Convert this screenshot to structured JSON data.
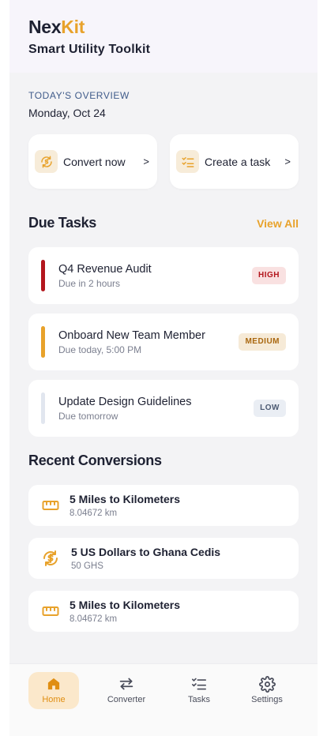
{
  "app": {
    "logo_part1": "Nex",
    "logo_part2": "Kit",
    "subtitle": "Smart Utility Toolkit",
    "accent_color": "#e8a22b"
  },
  "overview": {
    "label": "TODAY'S OVERVIEW",
    "date": "Monday, Oct 24"
  },
  "quick_actions": [
    {
      "label": "Convert now",
      "chevron": ">",
      "icon": "convert-icon"
    },
    {
      "label": "Create a task",
      "chevron": ">",
      "icon": "checklist-icon"
    }
  ],
  "due_tasks": {
    "title": "Due Tasks",
    "view_all": "View All",
    "items": [
      {
        "title": "Q4 Revenue Audit",
        "due": "Due in 2 hours",
        "priority": "HIGH",
        "bar_color": "#b3161d",
        "badge_bg": "#f9e1e1",
        "badge_color": "#b3161d"
      },
      {
        "title": "Onboard New Team Member",
        "due": "Due today, 5:00 PM",
        "priority": "MEDIUM",
        "bar_color": "#e8a22b",
        "badge_bg": "#f6ead7",
        "badge_color": "#a9670f"
      },
      {
        "title": "Update Design Guidelines",
        "due": "Due tomorrow",
        "priority": "LOW",
        "bar_color": "#e1e6ef",
        "badge_bg": "#eaeef4",
        "badge_color": "#4b5a72"
      }
    ]
  },
  "recent_conversions": {
    "title": "Recent Conversions",
    "items": [
      {
        "title": "5 Miles to Kilometers",
        "result": "8.04672 km",
        "icon": "ruler-icon"
      },
      {
        "title": "5 US Dollars to Ghana Cedis",
        "result": "50 GHS",
        "icon": "currency-exchange-icon"
      },
      {
        "title": "5 Miles to Kilometers",
        "result": "8.04672 km",
        "icon": "ruler-icon"
      }
    ]
  },
  "nav": {
    "items": [
      {
        "label": "Home",
        "icon": "home-icon",
        "active": true
      },
      {
        "label": "Converter",
        "icon": "swap-arrows-icon",
        "active": false
      },
      {
        "label": "Tasks",
        "icon": "checklist-icon",
        "active": false
      },
      {
        "label": "Settings",
        "icon": "gear-icon",
        "active": false
      }
    ]
  }
}
